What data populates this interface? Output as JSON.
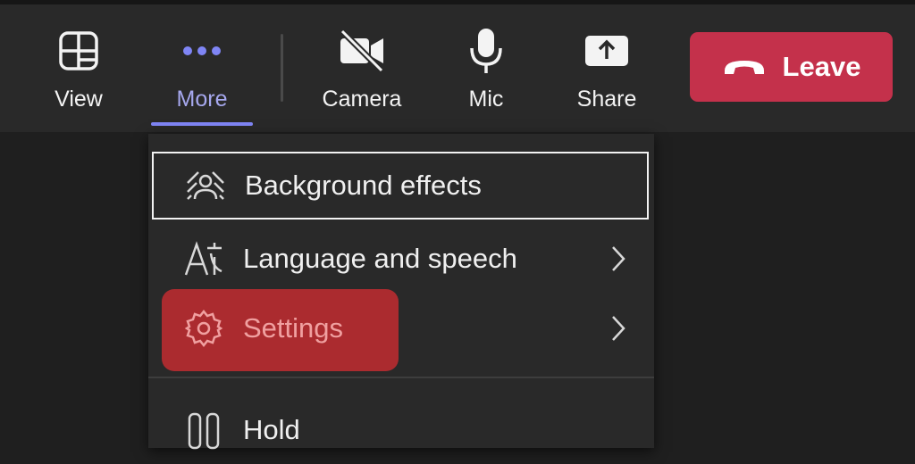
{
  "toolbar": {
    "view_label": "View",
    "more_label": "More",
    "camera_label": "Camera",
    "mic_label": "Mic",
    "share_label": "Share",
    "leave_label": "Leave"
  },
  "icons": {
    "view": "layout-grid-icon",
    "more": "more-dots-icon",
    "camera": "camera-off-icon",
    "mic": "microphone-icon",
    "share": "share-screen-icon",
    "leave": "hang-up-phone-icon",
    "background": "background-effects-icon",
    "language": "language-icon",
    "settings": "gear-icon",
    "hold": "pause-icon",
    "chevron": "chevron-right-icon"
  },
  "colors": {
    "accent": "#7f85f5",
    "leave": "#c4314b",
    "highlight": "#b52b2f"
  },
  "menu": {
    "items": [
      {
        "label": "Background effects",
        "has_submenu": false
      },
      {
        "label": "Language and speech",
        "has_submenu": true
      },
      {
        "label": "Settings",
        "has_submenu": true
      },
      {
        "label": "Hold",
        "has_submenu": false
      }
    ]
  }
}
